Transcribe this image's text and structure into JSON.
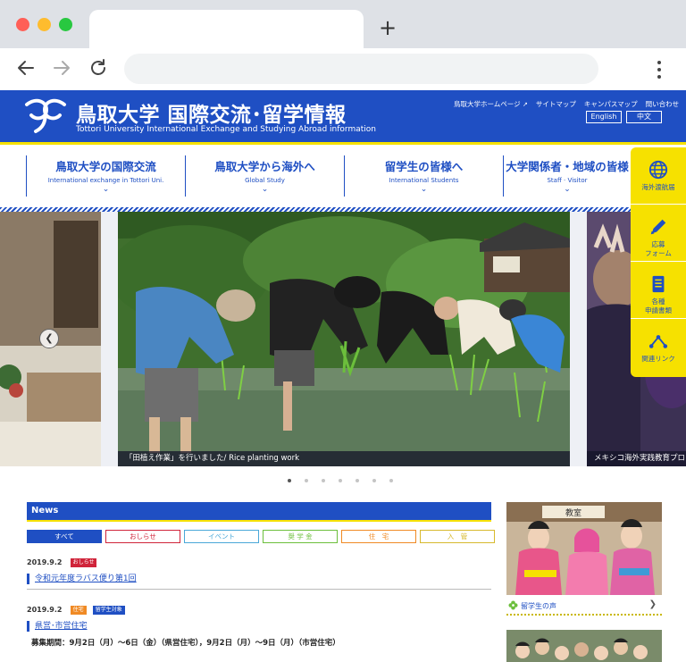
{
  "browser": {
    "new_tab": "+"
  },
  "site": {
    "title": "鳥取大学 国際交流･留学情報",
    "subtitle": "Tottori University International Exchange and Studying Abroad information",
    "util_links": [
      "鳥取大学ホームページ",
      "サイトマップ",
      "キャンパスマップ",
      "問い合わせ"
    ],
    "lang": {
      "english": "English",
      "chinese": "中文"
    }
  },
  "gnav": [
    {
      "title": "鳥取大学の国際交流",
      "sub": "International exchange in Tottori Uni."
    },
    {
      "title": "鳥取大学から海外へ",
      "sub": "Global Study"
    },
    {
      "title": "留学生の皆様へ",
      "sub": "International Students"
    },
    {
      "title": "大学関係者・地域の皆様",
      "sub": "Staff · Visitor"
    }
  ],
  "slider": {
    "main_caption": "「田植え作業」を行いました/ Rice planting work",
    "right_caption": "メキシコ海外実践教育プロ",
    "dots": 7,
    "active_dot": 1
  },
  "side_tabs": [
    {
      "label": "海外渡航届",
      "icon": "globe-icon"
    },
    {
      "label": "応募\nフォーム",
      "icon": "pencil-icon"
    },
    {
      "label": "各種\n申請書類",
      "icon": "document-icon"
    },
    {
      "label": "関連リンク",
      "icon": "share-icon"
    }
  ],
  "news": {
    "heading": "News",
    "filters": [
      {
        "label": "すべて",
        "color": "#1f4fc3",
        "active": true
      },
      {
        "label": "おしらせ",
        "color": "#d0243a",
        "active": false
      },
      {
        "label": "イベント",
        "color": "#4aa8d8",
        "active": false
      },
      {
        "label": "奨 学 金",
        "color": "#6cbf3c",
        "active": false
      },
      {
        "label": "住　宅",
        "color": "#f08a24",
        "active": false
      },
      {
        "label": "入　管",
        "color": "#d7b92d",
        "active": false
      }
    ],
    "items": [
      {
        "date": "2019.9.2",
        "tags": [
          {
            "label": "おしらせ",
            "color": "#d0243a"
          }
        ],
        "title": "令和元年度ラバス便り第1回"
      },
      {
        "date": "2019.9.2",
        "tags": [
          {
            "label": "住宅",
            "color": "#f08a24"
          },
          {
            "label": "留学生対象",
            "color": "#1f4fc3"
          }
        ],
        "title": "県営･市営住宅"
      }
    ],
    "body_text": "募集期間：9月2日（月）〜6日（金）（県営住宅），9月2日（月）〜9日（月）（市営住宅）"
  },
  "voice": {
    "label": "留学生の声",
    "photo_sign": "教室"
  },
  "colors": {
    "brand_blue": "#1f4fc3",
    "brand_yellow": "#f6e100"
  }
}
